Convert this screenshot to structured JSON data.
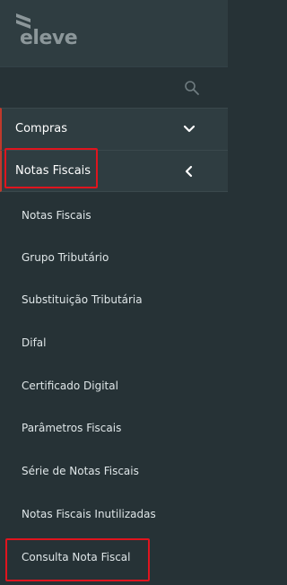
{
  "brand": {
    "logo_text": "eleve"
  },
  "search": {
    "icon": "search-icon"
  },
  "menu": {
    "compras": {
      "label": "Compras",
      "icon": "chevron-down-icon"
    },
    "notas_fiscais": {
      "label": "Notas Fiscais",
      "icon": "chevron-left-icon"
    }
  },
  "submenu": {
    "items": [
      {
        "label": "Notas Fiscais"
      },
      {
        "label": "Grupo Tributário"
      },
      {
        "label": "Substituição Tributária"
      },
      {
        "label": "Difal"
      },
      {
        "label": "Certificado Digital"
      },
      {
        "label": "Parâmetros Fiscais"
      },
      {
        "label": "Série de Notas Fiscais"
      },
      {
        "label": "Notas Fiscais Inutilizadas"
      },
      {
        "label": "Consulta Nota Fiscal"
      }
    ]
  },
  "colors": {
    "sidebar_bg": "#263236",
    "header_bg": "#2f3d41",
    "accent_red": "#e0141e",
    "text": "#ffffff"
  }
}
